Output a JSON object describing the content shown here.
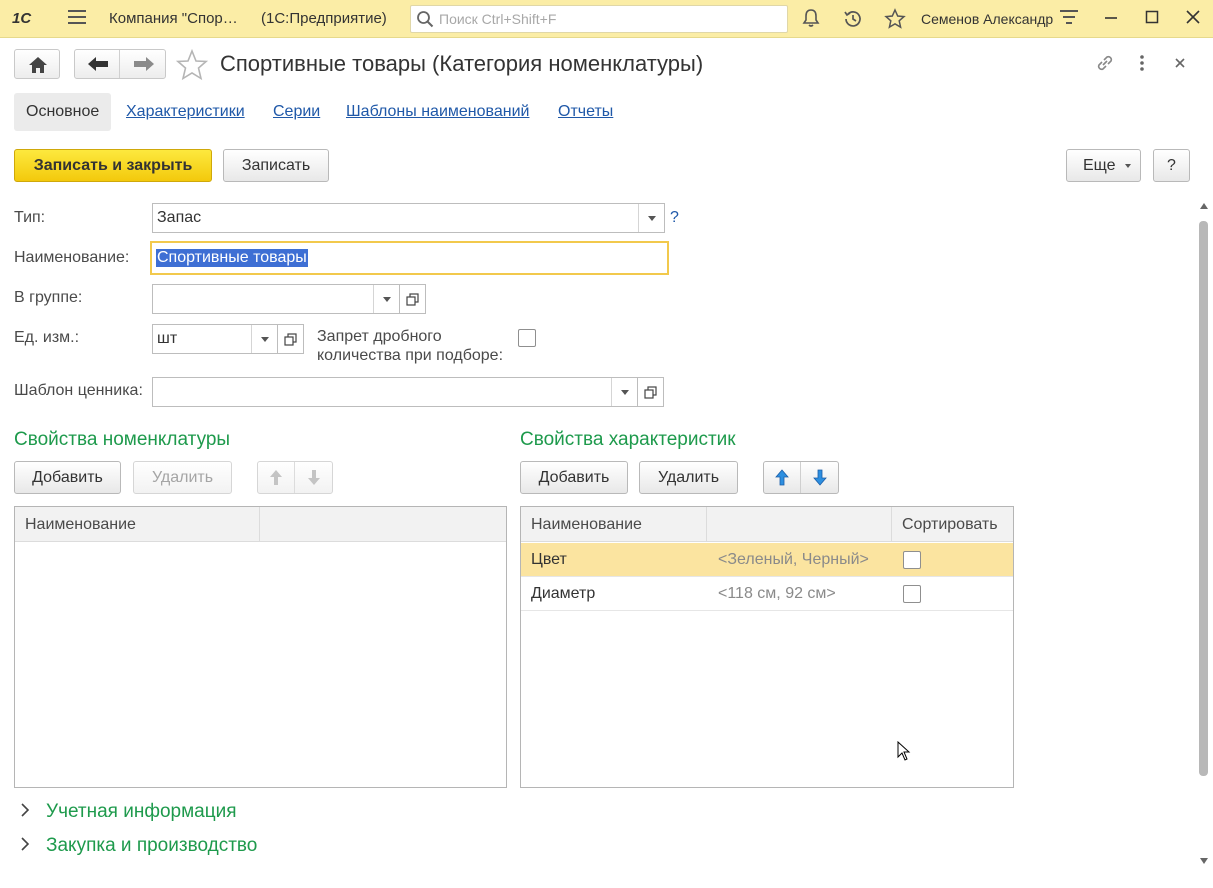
{
  "topbar": {
    "logo": "1С",
    "app_title": "Компания \"Спор…",
    "platform": "(1С:Предприятие)",
    "search_placeholder": "Поиск Ctrl+Shift+F",
    "user": "Семенов Александр"
  },
  "header": {
    "title": "Спортивные товары (Категория номенклатуры)"
  },
  "tabs": [
    {
      "label": "Основное"
    },
    {
      "label": "Характеристики"
    },
    {
      "label": "Серии"
    },
    {
      "label": "Шаблоны наименований"
    },
    {
      "label": "Отчеты"
    }
  ],
  "toolbar": {
    "save_close": "Записать и закрыть",
    "save": "Записать",
    "more": "Еще",
    "help": "?"
  },
  "form": {
    "type_label": "Тип:",
    "type_value": "Запас",
    "type_help": "?",
    "name_label": "Наименование:",
    "name_value": "Спортивные товары",
    "group_label": "В группе:",
    "group_value": "",
    "unit_label": "Ед. изм.:",
    "unit_value": "шт",
    "fractional_label_1": "Запрет дробного",
    "fractional_label_2": "количества при подборе:",
    "fractional_checked": false,
    "price_template_label": "Шаблон ценника:",
    "price_template_value": ""
  },
  "nomenclature_props": {
    "title": "Свойства номенклатуры",
    "add": "Добавить",
    "delete": "Удалить",
    "columns": [
      "Наименование",
      ""
    ],
    "rows": []
  },
  "characteristic_props": {
    "title": "Свойства характеристик",
    "add": "Добавить",
    "delete": "Удалить",
    "columns": [
      "Наименование",
      "",
      "Сортировать"
    ],
    "rows": [
      {
        "name": "Цвет",
        "values": "<Зеленый, Черный>",
        "sort": false,
        "selected": true
      },
      {
        "name": "Диаметр",
        "values": "<118 см, 92 см>",
        "sort": false,
        "selected": false
      }
    ]
  },
  "groups": [
    {
      "label": "Учетная информация"
    },
    {
      "label": "Закупка и производство"
    }
  ],
  "colors": {
    "topbar": "#fbeda6",
    "accent_green": "#1e9a4c",
    "link_blue": "#1f58a8",
    "primary_button": "#f5d11a",
    "selected_row": "#fbe4a0"
  }
}
